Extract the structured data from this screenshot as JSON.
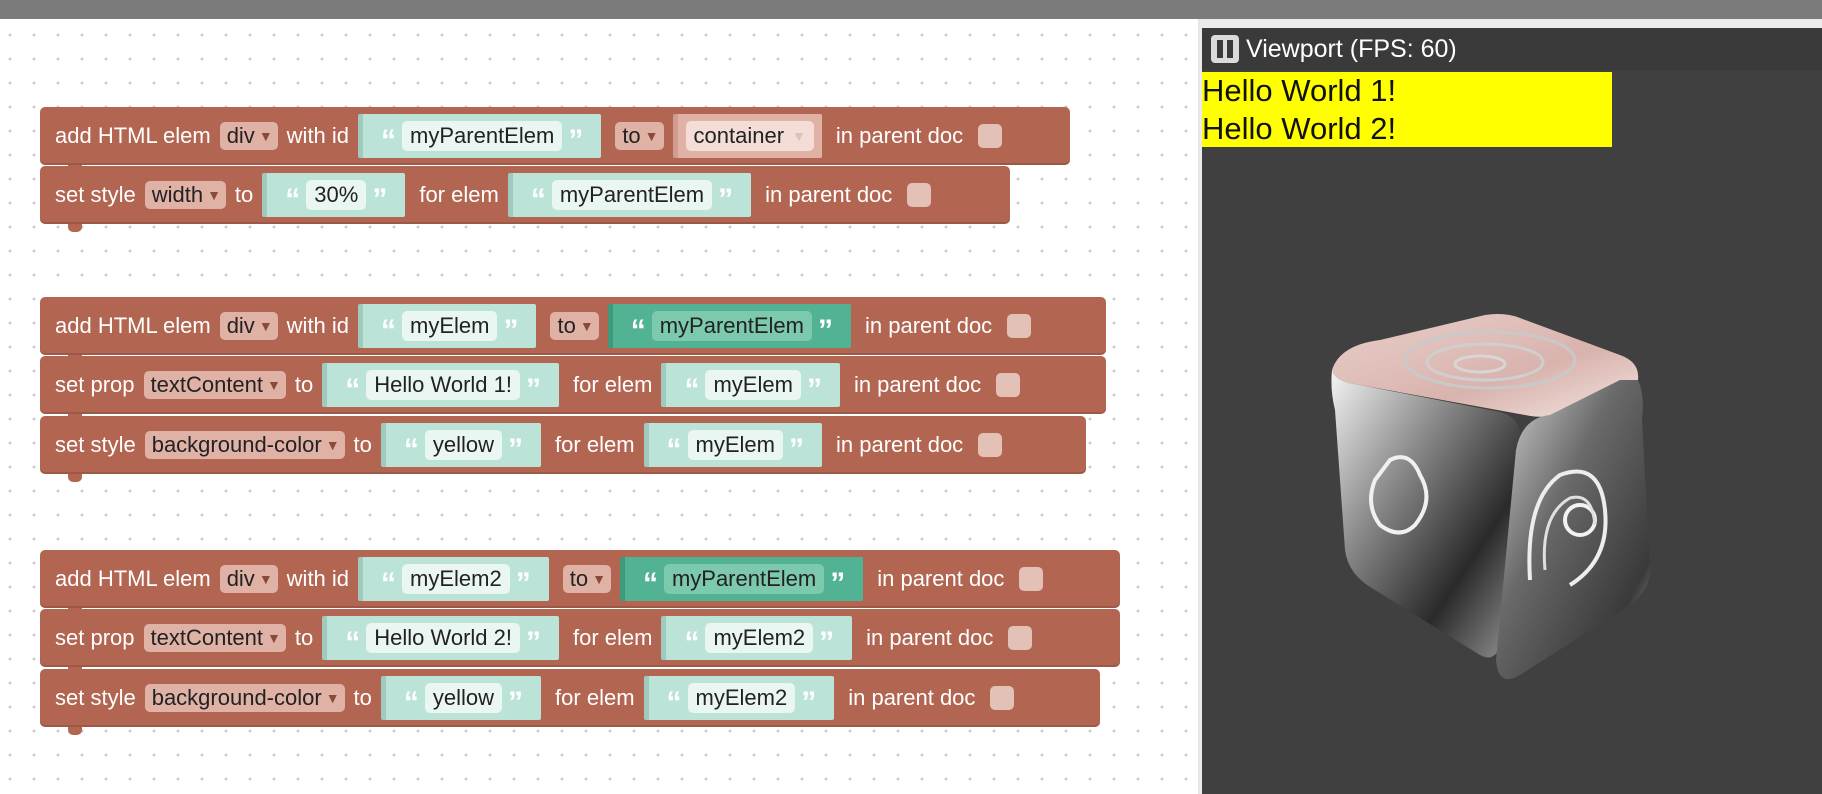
{
  "workspace": {
    "groups": [
      {
        "blocks": [
          {
            "type": "add",
            "label1": "add HTML elem",
            "tag": "div",
            "label2": "with id",
            "id": "myParentElem",
            "label3": "to",
            "parent_dropdown": "container",
            "label4": "in parent doc"
          },
          {
            "type": "style",
            "label1": "set style",
            "prop": "width",
            "label2": "to",
            "value": "30%",
            "label3": "for elem",
            "elem": "myParentElem",
            "label4": "in parent doc"
          }
        ]
      },
      {
        "blocks": [
          {
            "type": "add",
            "label1": "add HTML elem",
            "tag": "div",
            "label2": "with id",
            "id": "myElem",
            "label3": "to",
            "parent": "myParentElem",
            "label4": "in parent doc"
          },
          {
            "type": "prop",
            "label1": "set prop",
            "prop": "textContent",
            "label2": "to",
            "value": "Hello World 1!",
            "label3": "for elem",
            "elem": "myElem",
            "label4": "in parent doc"
          },
          {
            "type": "style",
            "label1": "set style",
            "prop": "background-color",
            "label2": "to",
            "value": "yellow",
            "label3": "for elem",
            "elem": "myElem",
            "label4": "in parent doc"
          }
        ]
      },
      {
        "blocks": [
          {
            "type": "add",
            "label1": "add HTML elem",
            "tag": "div",
            "label2": "with id",
            "id": "myElem2",
            "label3": "to",
            "parent": "myParentElem",
            "label4": "in parent doc"
          },
          {
            "type": "prop",
            "label1": "set prop",
            "prop": "textContent",
            "label2": "to",
            "value": "Hello World 2!",
            "label3": "for elem",
            "elem": "myElem2",
            "label4": "in parent doc"
          },
          {
            "type": "style",
            "label1": "set style",
            "prop": "background-color",
            "label2": "to",
            "value": "yellow",
            "label3": "for elem",
            "elem": "myElem2",
            "label4": "in parent doc"
          }
        ]
      }
    ],
    "quote_open": "“",
    "quote_close": "”",
    "dropdown_arrow": "▼"
  },
  "viewport": {
    "title": "Viewport (FPS: 60)",
    "pause_icon": "pause-icon",
    "hello_lines": [
      "Hello World 1!",
      "Hello World 2!"
    ],
    "hello_background": "#ffff00",
    "background": "#404040"
  },
  "colors": {
    "block": "#b26652",
    "string_input": "#bce3d7",
    "string_input_dark": "#52b394",
    "dropdown": "#e0b2a6"
  }
}
